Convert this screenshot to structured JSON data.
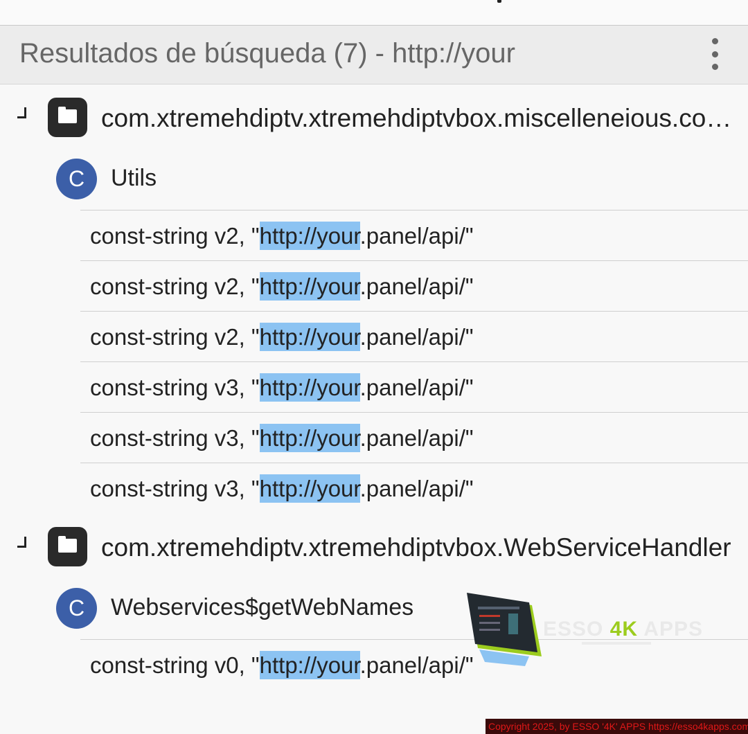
{
  "header": {
    "title": "Resultados de búsqueda (7) - http://your",
    "menu_icon": "more-vertical-icon"
  },
  "groups": [
    {
      "package": "com.xtremehdiptv.xtremehdiptvbox.miscelleneious.common",
      "class_badge": "C",
      "class_name": "Utils",
      "results": [
        {
          "before": "const-string v2, \"",
          "match": "http://your",
          "after": ".panel/api/\""
        },
        {
          "before": "const-string v2, \"",
          "match": "http://your",
          "after": ".panel/api/\""
        },
        {
          "before": "const-string v2, \"",
          "match": "http://your",
          "after": ".panel/api/\""
        },
        {
          "before": "const-string v3, \"",
          "match": "http://your",
          "after": ".panel/api/\""
        },
        {
          "before": "const-string v3, \"",
          "match": "http://your",
          "after": ".panel/api/\""
        },
        {
          "before": "const-string v3, \"",
          "match": "http://your",
          "after": ".panel/api/\""
        }
      ]
    },
    {
      "package": "com.xtremehdiptv.xtremehdiptvbox.WebServiceHandler",
      "class_badge": "C",
      "class_name": "Webservices$getWebNames",
      "results": [
        {
          "before": "const-string v0, \"",
          "match": "http://your",
          "after": ".panel/api/\""
        }
      ]
    }
  ],
  "watermark": {
    "brand_a": "ESSO ",
    "brand_b": "4K",
    "brand_c": " APPS",
    "copyright": "Copyright 2025, by ESSO '4K' APPS https://esso4kapps.com/"
  },
  "colors": {
    "highlight": "#8cc3f2",
    "class_badge": "#3c5fa8",
    "package_icon_bg": "#2a2a2a",
    "watermark_accent": "#9ccc1e",
    "copyright_text": "#e01818"
  }
}
